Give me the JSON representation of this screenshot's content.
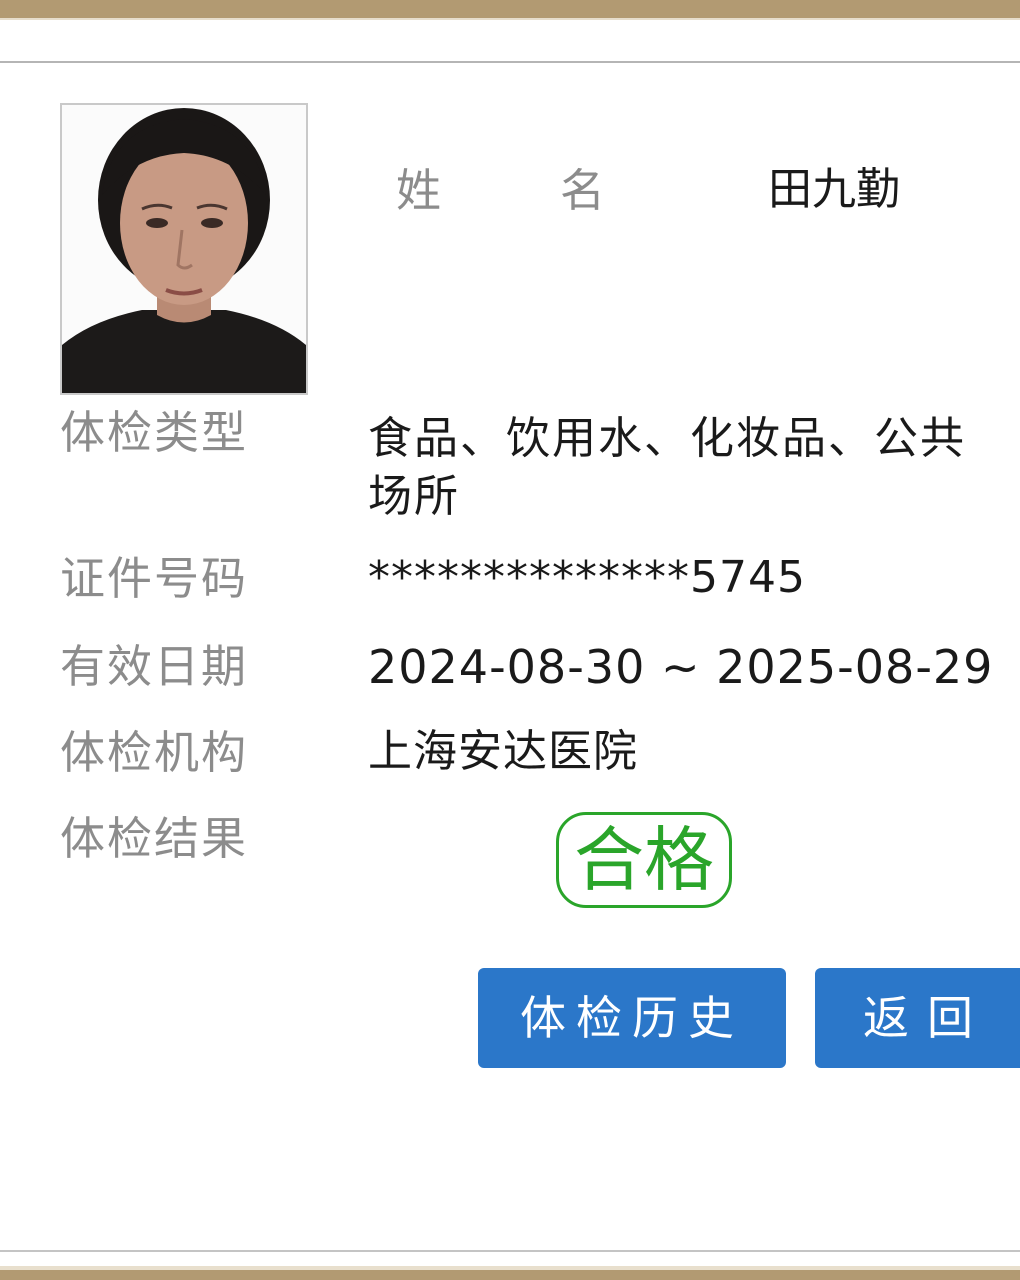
{
  "colors": {
    "frame": "#b29a72",
    "label": "#8c8c8c",
    "value": "#1a1a1a",
    "pass_stamp": "#2aa52a",
    "button": "#2b77c9"
  },
  "person": {
    "photo": "portrait-photo",
    "name_label_part1": "姓",
    "name_label_part2": "名",
    "name": "田九勤"
  },
  "fields": {
    "exam_type_label": "体检类型",
    "exam_type_value": "食品、饮用水、化妆品、公共场所",
    "id_label": "证件号码",
    "id_value": "**************5745",
    "valid_label": "有效日期",
    "valid_value": "2024-08-30 ~ 2025-08-29",
    "org_label": "体检机构",
    "org_value": "上海安达医院",
    "result_label": "体检结果",
    "result_value": "合格"
  },
  "buttons": {
    "history": "体检历史",
    "back": "返回"
  }
}
